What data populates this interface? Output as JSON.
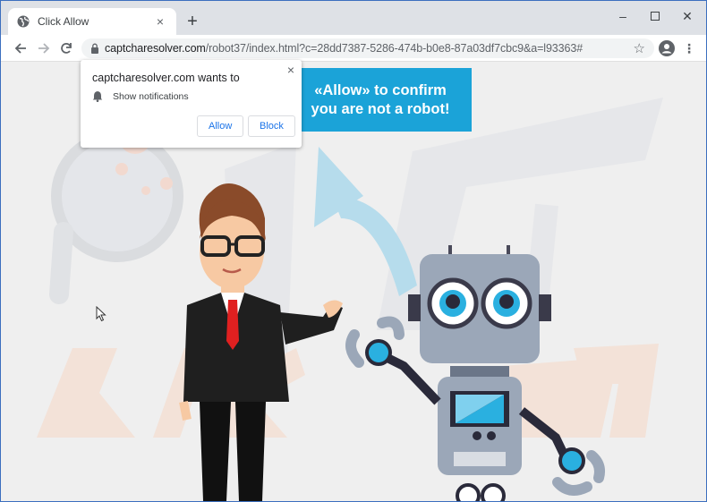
{
  "tab": {
    "title": "Click Allow",
    "close": "×"
  },
  "toolbar": {
    "url_prefix": "captcharesolver.com",
    "url_rest": "/robot37/index.html?c=28dd7387-5286-474b-b0e8-87a03df7cbc9&a=l93363#"
  },
  "popup": {
    "title": "captcharesolver.com wants to",
    "permission": "Show notifications",
    "allow_label": "Allow",
    "block_label": "Block",
    "close": "×"
  },
  "banner": {
    "line1": "«Allow» to confirm",
    "line2": "you are not a robot!"
  },
  "colors": {
    "banner_bg": "#1ba3d8",
    "button_text": "#1a73e8",
    "window_frame": "#3c6fbf"
  }
}
